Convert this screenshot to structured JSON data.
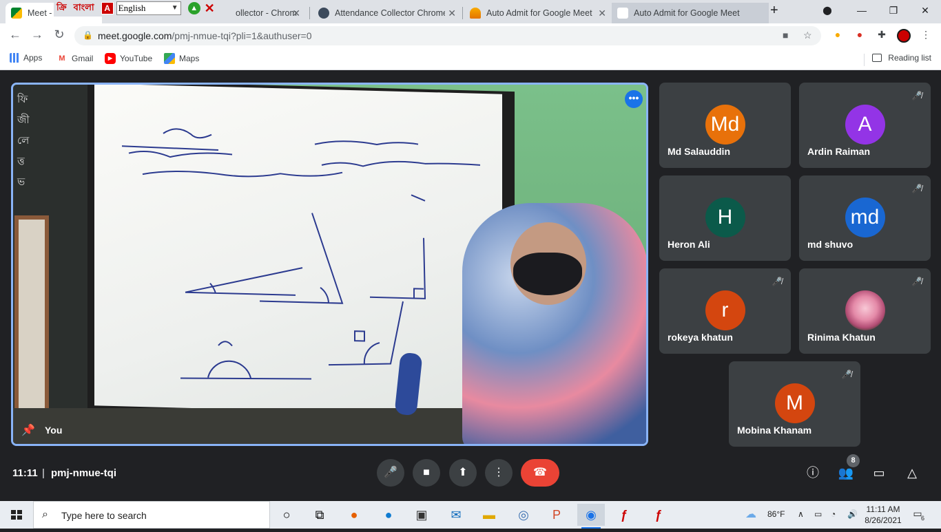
{
  "browser": {
    "tabs": [
      {
        "title": "Meet -",
        "active": true
      },
      {
        "title": "ollector - Chrom"
      },
      {
        "title": "Attendance Collector Chrome"
      },
      {
        "title": "Auto Admit for Google Meet"
      },
      {
        "title": "Auto Admit for Google Meet"
      }
    ],
    "overlay": {
      "logo": "ক্রি",
      "bangla_label": "বাংলা",
      "language_select": "English"
    },
    "url_host": "meet.google.com",
    "url_path": "/pmj-nmue-tqi?pli=1&authuser=0",
    "bookmarks": [
      {
        "label": "Apps",
        "icon": "apps-grid-icon"
      },
      {
        "label": "Gmail",
        "icon": "gmail-icon"
      },
      {
        "label": "YouTube",
        "icon": "youtube-icon"
      },
      {
        "label": "Maps",
        "icon": "maps-icon"
      }
    ],
    "reading_list": "Reading list"
  },
  "meet": {
    "self_label": "You",
    "participants": [
      {
        "initials": "Md",
        "name": "Md Salauddin",
        "color": "#e8710a",
        "muted": false
      },
      {
        "initials": "A",
        "name": "Ardin Raiman",
        "color": "#9334e6",
        "muted": true
      },
      {
        "initials": "H",
        "name": "Heron Ali",
        "color": "#0b5a4a",
        "muted": false
      },
      {
        "initials": "md",
        "name": "md shuvo",
        "color": "#1967d2",
        "muted": true
      },
      {
        "initials": "r",
        "name": "rokeya khatun",
        "color": "#d4460f",
        "muted": true
      },
      {
        "initials": "",
        "name": "Rinima Khatun",
        "color": "#3c4043",
        "muted": true
      },
      {
        "initials": "M",
        "name": "Mobina Khanam",
        "color": "#d4460f",
        "muted": true
      }
    ],
    "time": "11:11",
    "meeting_code": "pmj-nmue-tqi",
    "people_count": "8"
  },
  "taskbar": {
    "search_placeholder": "Type here to search",
    "weather": "86°F",
    "time": "11:11 AM",
    "date": "8/26/2021",
    "notifications": "6"
  }
}
